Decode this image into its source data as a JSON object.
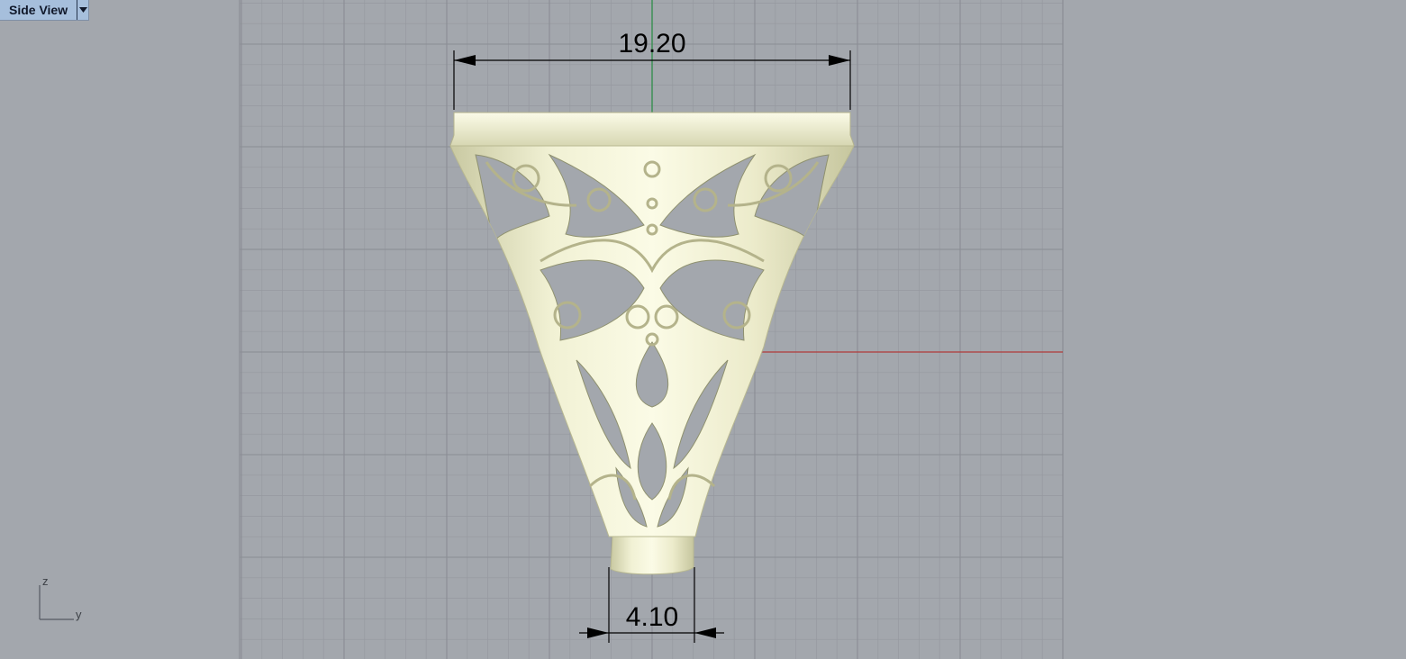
{
  "viewport": {
    "title": "Side View",
    "dropdown_icon": "triangle-down-icon",
    "background_color": "#a3a7ad",
    "grid_minor_color": "#9699a0",
    "grid_major_color": "#8a8d94",
    "x_axis_color": "#b03a3a",
    "z_axis_color": "#2f8f4a",
    "object_color": "#e9e9c8"
  },
  "dimensions": {
    "top_width": "19.20",
    "bottom_width": "4.10"
  },
  "axis_gizmo": {
    "vertical_label": "z",
    "horizontal_label": "y",
    "icon": "axis-triad-icon"
  }
}
